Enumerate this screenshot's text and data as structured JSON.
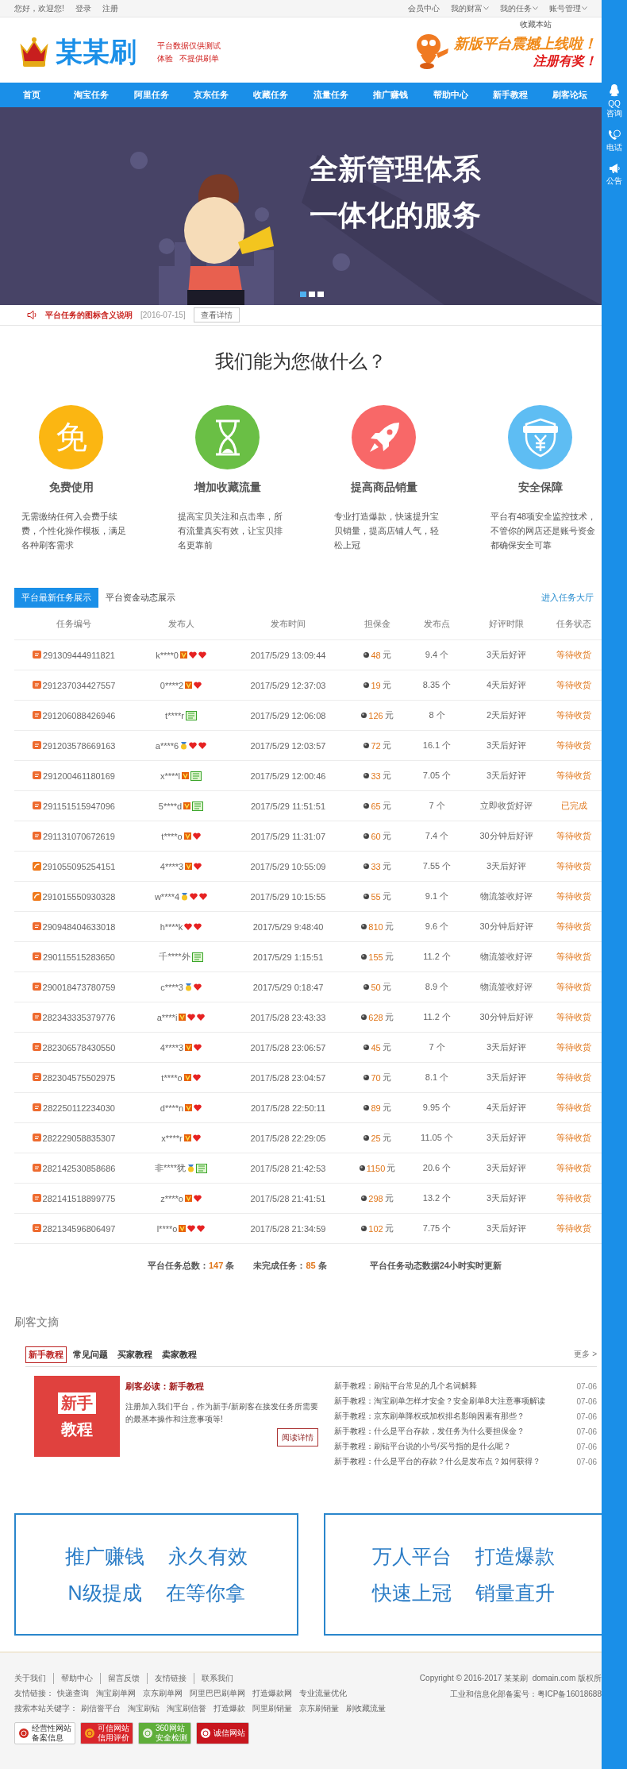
{
  "top_bar": {
    "greeting": "您好，欢迎您!",
    "links": [
      "登录",
      "注册"
    ],
    "menus": [
      {
        "label": "会员中心",
        "dropdown": false
      },
      {
        "label": "我的财富",
        "dropdown": true
      },
      {
        "label": "我的任务",
        "dropdown": true
      },
      {
        "label": "账号管理",
        "dropdown": true
      }
    ]
  },
  "header": {
    "bookmark": "收藏本站",
    "logo": "某某刷",
    "notice_lines": [
      "平台数据仅供测试",
      "体验   不提供刷单"
    ],
    "ad_line1": "新版平台震撼上线啦！",
    "ad_line2": "注册有奖！"
  },
  "nav": [
    "首页",
    "淘宝任务",
    "阿里任务",
    "京东任务",
    "收藏任务",
    "流量任务",
    "推广赚钱",
    "帮助中心",
    "新手教程",
    "刷客论坛"
  ],
  "banner": {
    "lines": [
      "全新管理体系",
      "一体化的服务"
    ],
    "dots": [
      {
        "selected": true
      },
      {
        "selected": false
      },
      {
        "selected": false
      }
    ]
  },
  "notice": {
    "title": "平台任务的图标含义说明",
    "date": "[2016-07-15]",
    "button": "查看详情"
  },
  "features": {
    "title": "我们能为您做什么？",
    "items": [
      {
        "kind": "text",
        "icon_text": "免",
        "color": "#fbb612",
        "title": "免费使用",
        "text": "无需缴纳任何入会费手续费，个性化操作模板，满足各种刷客需求"
      },
      {
        "kind": "hourglass",
        "color": "#6abf45",
        "title": "增加收藏流量",
        "text": "提高宝贝关注和点击率，所有流量真实有效，让宝贝排名更靠前"
      },
      {
        "kind": "rocket",
        "color": "#f86868",
        "title": "提高商品销量",
        "text": "专业打造爆款，快速提升宝贝销量，提高店铺人气，轻松上冠"
      },
      {
        "kind": "shield",
        "color": "#5ebdf3",
        "title": "安全保障",
        "text": "平台有48项安全监控技术，不管你的网店还是账号资金都确保安全可靠"
      }
    ]
  },
  "tasks": {
    "tabs": [
      {
        "label": "平台最新任务展示",
        "selected": true
      },
      {
        "label": "平台资金动态展示",
        "selected": false
      }
    ],
    "hall_link": "进入任务大厅",
    "columns": [
      "任务编号",
      "发布人",
      "发布时间",
      "担保金",
      "发布点",
      "好评时限",
      "任务状态"
    ],
    "rows": [
      {
        "kind": "square",
        "id": "291309444911821",
        "user": "k****0",
        "badges": [
          {
            "kind": "level"
          },
          {
            "kind": "heart"
          },
          {
            "kind": "heart"
          }
        ],
        "time": "2017/5/29 13:09:44",
        "amount": "48",
        "unit": "元",
        "points": "9.4 个",
        "review": "3天后好评",
        "status": "等待收货"
      },
      {
        "kind": "square",
        "id": "291237034427557",
        "user": "0****2",
        "badges": [
          {
            "kind": "level"
          },
          {
            "kind": "heart"
          }
        ],
        "time": "2017/5/29 12:37:03",
        "amount": "19",
        "unit": "元",
        "points": "8.35 个",
        "review": "4天后好评",
        "status": "等待收货"
      },
      {
        "kind": "square",
        "id": "291206088426946",
        "user": "t****r",
        "badges": [
          {
            "kind": "vip"
          }
        ],
        "time": "2017/5/29 12:06:08",
        "amount": "126",
        "unit": "元",
        "points": "8 个",
        "review": "2天后好评",
        "status": "等待收货"
      },
      {
        "kind": "square",
        "id": "291203578669163",
        "user": "a****6",
        "badges": [
          {
            "kind": "medal"
          },
          {
            "kind": "heart"
          },
          {
            "kind": "heart"
          }
        ],
        "time": "2017/5/29 12:03:57",
        "amount": "72",
        "unit": "元",
        "points": "16.1 个",
        "review": "3天后好评",
        "status": "等待收货"
      },
      {
        "kind": "square",
        "id": "291200461180169",
        "user": "x****l",
        "badges": [
          {
            "kind": "level"
          },
          {
            "kind": "vip"
          }
        ],
        "time": "2017/5/29 12:00:46",
        "amount": "33",
        "unit": "元",
        "points": "7.05 个",
        "review": "3天后好评",
        "status": "等待收货"
      },
      {
        "kind": "square",
        "id": "291151515947096",
        "user": "5****d",
        "badges": [
          {
            "kind": "level"
          },
          {
            "kind": "vip"
          }
        ],
        "time": "2017/5/29 11:51:51",
        "amount": "65",
        "unit": "元",
        "points": "7 个",
        "review": "立即收货好评",
        "status": "已完成"
      },
      {
        "kind": "square",
        "id": "291131070672619",
        "user": "t****o",
        "badges": [
          {
            "kind": "level"
          },
          {
            "kind": "heart"
          }
        ],
        "time": "2017/5/29 11:31:07",
        "amount": "60",
        "unit": "元",
        "points": "7.4 个",
        "review": "30分钟后好评",
        "status": "等待收货"
      },
      {
        "kind": "round",
        "id": "291055095254151",
        "user": "4****3",
        "badges": [
          {
            "kind": "level"
          },
          {
            "kind": "heart"
          }
        ],
        "time": "2017/5/29 10:55:09",
        "amount": "33",
        "unit": "元",
        "points": "7.55 个",
        "review": "3天后好评",
        "status": "等待收货"
      },
      {
        "kind": "round",
        "id": "291015550930328",
        "user": "w****4",
        "badges": [
          {
            "kind": "medal"
          },
          {
            "kind": "heart"
          },
          {
            "kind": "heart"
          }
        ],
        "time": "2017/5/29 10:15:55",
        "amount": "55",
        "unit": "元",
        "points": "9.1 个",
        "review": "物流签收好评",
        "status": "等待收货"
      },
      {
        "kind": "square",
        "id": "290948404633018",
        "user": "h****k",
        "badges": [
          {
            "kind": "heart"
          },
          {
            "kind": "heart"
          }
        ],
        "time": "2017/5/29 9:48:40",
        "amount": "810",
        "unit": "元",
        "points": "9.6 个",
        "review": "30分钟后好评",
        "status": "等待收货"
      },
      {
        "kind": "square",
        "id": "290115515283650",
        "user": "千****外",
        "badges": [
          {
            "kind": "vip"
          }
        ],
        "time": "2017/5/29 1:15:51",
        "amount": "155",
        "unit": "元",
        "points": "11.2 个",
        "review": "物流签收好评",
        "status": "等待收货"
      },
      {
        "kind": "square",
        "id": "290018473780759",
        "user": "c****3",
        "badges": [
          {
            "kind": "medal"
          },
          {
            "kind": "heart"
          }
        ],
        "time": "2017/5/29 0:18:47",
        "amount": "50",
        "unit": "元",
        "points": "8.9 个",
        "review": "物流签收好评",
        "status": "等待收货"
      },
      {
        "kind": "square",
        "id": "282343335379776",
        "user": "a****i",
        "badges": [
          {
            "kind": "level"
          },
          {
            "kind": "heart"
          },
          {
            "kind": "heart"
          }
        ],
        "time": "2017/5/28 23:43:33",
        "amount": "628",
        "unit": "元",
        "points": "11.2 个",
        "review": "30分钟后好评",
        "status": "等待收货"
      },
      {
        "kind": "square",
        "id": "282306578430550",
        "user": "4****3",
        "badges": [
          {
            "kind": "level"
          },
          {
            "kind": "heart"
          }
        ],
        "time": "2017/5/28 23:06:57",
        "amount": "45",
        "unit": "元",
        "points": "7 个",
        "review": "3天后好评",
        "status": "等待收货"
      },
      {
        "kind": "square",
        "id": "282304575502975",
        "user": "t****o",
        "badges": [
          {
            "kind": "level"
          },
          {
            "kind": "heart"
          }
        ],
        "time": "2017/5/28 23:04:57",
        "amount": "70",
        "unit": "元",
        "points": "8.1 个",
        "review": "3天后好评",
        "status": "等待收货"
      },
      {
        "kind": "square",
        "id": "282250112234030",
        "user": "d****n",
        "badges": [
          {
            "kind": "level"
          },
          {
            "kind": "heart"
          }
        ],
        "time": "2017/5/28 22:50:11",
        "amount": "89",
        "unit": "元",
        "points": "9.95 个",
        "review": "4天后好评",
        "status": "等待收货"
      },
      {
        "kind": "square",
        "id": "282229058835307",
        "user": "x****r",
        "badges": [
          {
            "kind": "level"
          },
          {
            "kind": "heart"
          }
        ],
        "time": "2017/5/28 22:29:05",
        "amount": "25",
        "unit": "元",
        "points": "11.05 个",
        "review": "3天后好评",
        "status": "等待收货"
      },
      {
        "kind": "square",
        "id": "282142530858686",
        "user": "非****犹",
        "badges": [
          {
            "kind": "medal"
          },
          {
            "kind": "vip"
          }
        ],
        "time": "2017/5/28 21:42:53",
        "amount": "1150",
        "unit": "元",
        "points": "20.6 个",
        "review": "3天后好评",
        "status": "等待收货"
      },
      {
        "kind": "square",
        "id": "282141518899775",
        "user": "z****o",
        "badges": [
          {
            "kind": "level"
          },
          {
            "kind": "heart"
          }
        ],
        "time": "2017/5/28 21:41:51",
        "amount": "298",
        "unit": "元",
        "points": "13.2 个",
        "review": "3天后好评",
        "status": "等待收货"
      },
      {
        "kind": "square",
        "id": "282134596806497",
        "user": "l****o",
        "badges": [
          {
            "kind": "level"
          },
          {
            "kind": "heart"
          },
          {
            "kind": "heart"
          }
        ],
        "time": "2017/5/28 21:34:59",
        "amount": "102",
        "unit": "元",
        "points": "7.75 个",
        "review": "3天后好评",
        "status": "等待收货"
      }
    ],
    "stats": [
      {
        "label": "平台任务总数：",
        "value": "147",
        "unit": "条"
      },
      {
        "label": "未完成任务：",
        "value": "85",
        "unit": "条"
      }
    ],
    "stats_note": "平台任务动态数据24小时实时更新"
  },
  "articles": {
    "title": "刷客文摘",
    "tabs": [
      {
        "label": "新手教程",
        "selected": true
      },
      {
        "label": "常见问题",
        "selected": false
      },
      {
        "label": "买家教程",
        "selected": false
      },
      {
        "label": "卖家教程",
        "selected": false
      }
    ],
    "more": "更多 >",
    "feature": {
      "image_lines": [
        "新手",
        "教程"
      ],
      "title": "刷客必读：新手教程",
      "text": "注册加入我们平台，作为新手/新刷客在接发任务所需要的最基本操作和注意事项等!",
      "button": "阅读详情"
    },
    "list": [
      {
        "title": "新手教程：刷钻平台常见的几个名词解释",
        "date": "07-06"
      },
      {
        "title": "新手教程：淘宝刷单怎样才安全？安全刷单8大注意事项解读",
        "date": "07-06"
      },
      {
        "title": "新手教程：京东刷单降权或加权排名影响因素有那些？",
        "date": "07-06"
      },
      {
        "title": "新手教程：什么是平台存款，发任务为什么要担保金？",
        "date": "07-06"
      },
      {
        "title": "新手教程：刷钻平台说的小号/买号指的是什么呢？",
        "date": "07-06"
      },
      {
        "title": "新手教程：什么是平台的存款？什么是发布点？如何获得？",
        "date": "07-06"
      }
    ]
  },
  "promos": [
    {
      "lines": [
        [
          "推广赚钱",
          "永久有效"
        ],
        [
          "N级提成",
          "在等你拿"
        ]
      ]
    },
    {
      "lines": [
        [
          "万人平台",
          "打造爆款"
        ],
        [
          "快速上冠",
          "销量直升"
        ]
      ]
    }
  ],
  "footer": {
    "links": [
      "关于我们",
      "帮助中心",
      "留言反馈",
      "友情链接",
      "联系我们"
    ],
    "friend_label": "友情链接：",
    "friends": [
      "快递查询",
      "淘宝刷单网",
      "京东刷单网",
      "阿里巴巴刷单网",
      "打造爆款网",
      "专业流量优化"
    ],
    "keyword_label": "搜索本站关键字：",
    "keywords": [
      "刷信誉平台",
      "淘宝刷钻",
      "淘宝刷信誉",
      "打造爆款",
      "阿里刷销量",
      "京东刷销量",
      "刷收藏流量"
    ],
    "badges": [
      {
        "kind": "record",
        "lines": [
          "经营性网站",
          "备案信息"
        ]
      },
      {
        "kind": "trust",
        "lines": [
          "可信网站",
          "信用评价"
        ]
      },
      {
        "kind": "scan",
        "lines": [
          "360网站",
          "安全检测"
        ]
      },
      {
        "kind": "honest",
        "lines": [
          "诚信网站"
        ]
      }
    ],
    "copyright": "Copyright © 2016-2017 某某刷  domain.com 版权所",
    "icp": "工业和信息化部备案号：粤ICP备16018688"
  },
  "side_bar": [
    {
      "kind": "qq",
      "label": "QQ咨询"
    },
    {
      "kind": "phone",
      "label": "电话"
    },
    {
      "kind": "notice",
      "label": "公告"
    }
  ]
}
